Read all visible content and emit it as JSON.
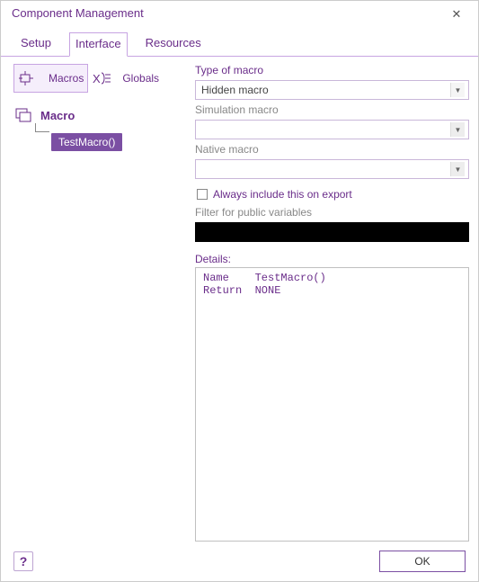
{
  "window": {
    "title": "Component Management"
  },
  "tabs": {
    "setup": "Setup",
    "interface": "Interface",
    "resources": "Resources"
  },
  "toolstrip": {
    "macros": "Macros",
    "globals": "Globals"
  },
  "tree": {
    "header": "Macro",
    "item": "TestMacro()"
  },
  "form": {
    "type_label": "Type of macro",
    "type_value": "Hidden macro",
    "sim_label": "Simulation macro",
    "sim_value": "",
    "native_label": "Native macro",
    "native_value": "",
    "always_include": "Always include this on export",
    "filter_label": "Filter for public variables",
    "details_label": "Details:",
    "details_text": "Name    TestMacro()\nReturn  NONE"
  },
  "footer": {
    "ok": "OK"
  }
}
